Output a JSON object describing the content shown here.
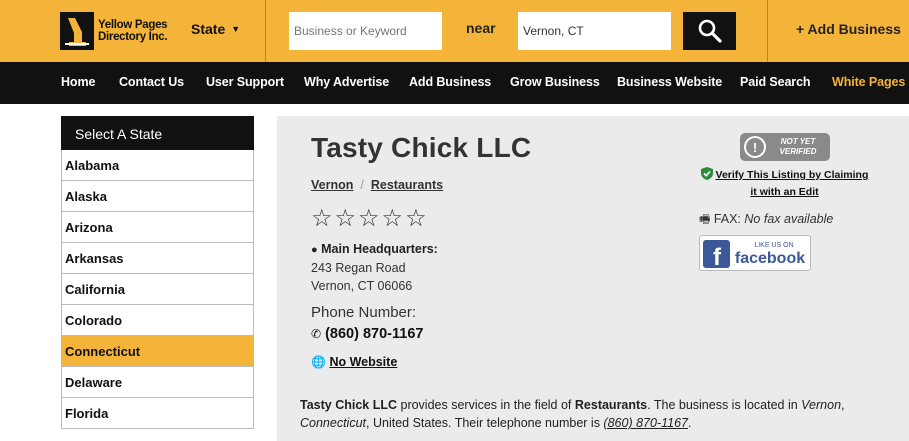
{
  "header": {
    "logo_line1": "Yellow Pages",
    "logo_line2": "Directory Inc.",
    "state_label": "State",
    "search_placeholder": "Business or Keyword",
    "near_label": "near",
    "location_value": "Vernon, CT",
    "add_business": "+ Add Business"
  },
  "nav": [
    "Home",
    "Contact Us",
    "User Support",
    "Why Advertise",
    "Add Business",
    "Grow Business",
    "Business Website",
    "Paid Search",
    "White Pages"
  ],
  "sidebar": {
    "title": "Select A State",
    "states": [
      "Alabama",
      "Alaska",
      "Arizona",
      "Arkansas",
      "California",
      "Colorado",
      "Connecticut",
      "Delaware",
      "Florida"
    ],
    "active": "Connecticut"
  },
  "listing": {
    "name": "Tasty Chick LLC",
    "city": "Vernon",
    "category": "Restaurants",
    "stars": "☆☆☆☆☆",
    "hq_label": "Main Headquarters:",
    "address_line1": "243 Regan Road",
    "address_line2": "Vernon, CT 06066",
    "phone_label": "Phone Number:",
    "phone": "(860) 870-1167",
    "website": "No Website",
    "badge_line1": "NOT YET",
    "badge_line2": "VERIFIED",
    "verify_line1": "Verify This Listing by Claiming",
    "verify_line2": "it with an Edit",
    "fax_label": "FAX:",
    "fax_value": "No fax available",
    "fb_small": "LIKE US ON",
    "fb_big": "facebook"
  },
  "description": {
    "biz": "Tasty Chick LLC",
    "t1": " provides services in the field of ",
    "category": "Restaurants",
    "t2": ". The business is located in ",
    "city": "Vernon",
    "t3": ", ",
    "state": "Connecticut",
    "t4": ", United States. Their telephone number is ",
    "phone": "(860) 870-1167",
    "t5": "."
  },
  "colors": {
    "brand_yellow": "#f4b43a",
    "nav_black": "#111111",
    "panel_gray": "#ebebeb",
    "fb_blue": "#3b5998",
    "verified_green": "#2e8b3a"
  }
}
